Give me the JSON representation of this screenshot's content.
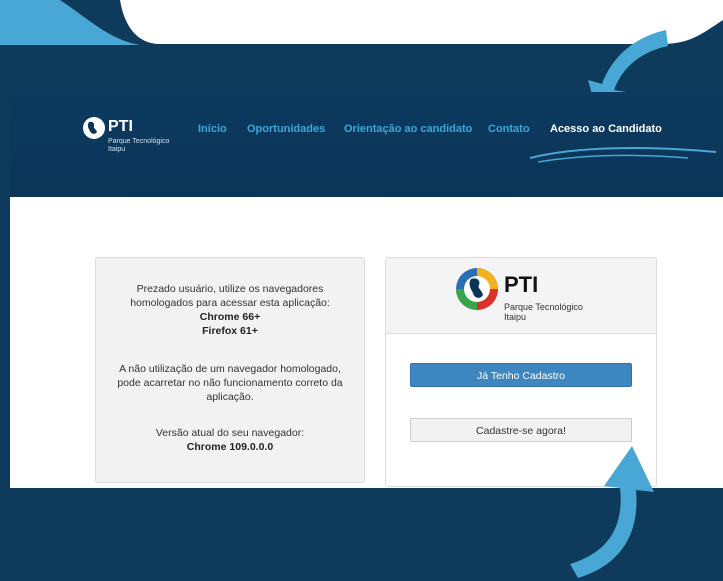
{
  "nav": {
    "logo_text": "PTI",
    "logo_sub_1": "Parque Tecnológico",
    "logo_sub_2": "Itaipu",
    "items": [
      {
        "label": "Início"
      },
      {
        "label": "Oportunidades"
      },
      {
        "label": "Orientação ao candidato"
      },
      {
        "label": "Contato"
      },
      {
        "label": "Acesso ao Candidato"
      }
    ]
  },
  "notice": {
    "line1": "Prezado usuário, utilize os navegadores",
    "line2": "homologados para acessar esta aplicação:",
    "browser1": "Chrome 66+",
    "browser2": "Firefox 61+",
    "warn1": "A não utilização de um navegador homologado,",
    "warn2": "pode acarretar no não funcionamento correto da",
    "warn3": "aplicação.",
    "version_label": "Versão atual do seu navegador:",
    "version_value": "Chrome 109.0.0.0"
  },
  "login": {
    "logo_text": "PTI",
    "logo_sub_1": "Parque Tecnológico",
    "logo_sub_2": "Itaipu",
    "have_account_button": "Já Tenho Cadastro",
    "register_button": "Cadastre-se agora!"
  },
  "colors": {
    "background": "#0e3a5c",
    "accent": "#3aa8d8",
    "primary_button": "#3d86bf"
  },
  "icons": [
    "pti-logo-icon",
    "curved-arrow-icon"
  ]
}
